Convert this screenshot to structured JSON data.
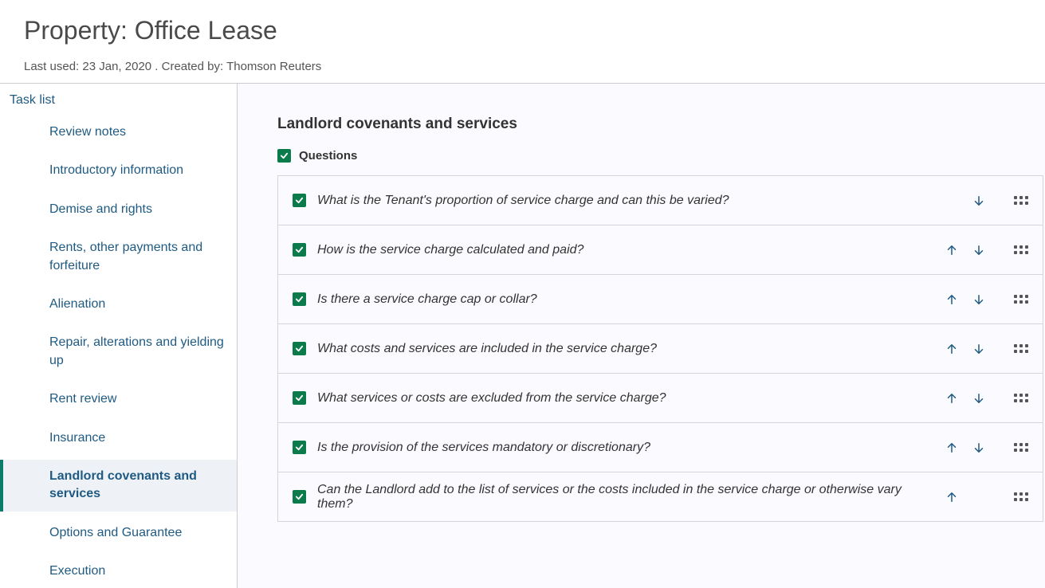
{
  "header": {
    "title": "Property: Office Lease",
    "meta": "Last used: 23 Jan, 2020 . Created by: Thomson Reuters"
  },
  "sidebar": {
    "title": "Task list",
    "items": [
      {
        "label": "Review notes",
        "active": false
      },
      {
        "label": "Introductory information",
        "active": false
      },
      {
        "label": "Demise and rights",
        "active": false
      },
      {
        "label": "Rents, other payments and forfeiture",
        "active": false
      },
      {
        "label": "Alienation",
        "active": false
      },
      {
        "label": "Repair, alterations and yielding up",
        "active": false
      },
      {
        "label": "Rent review",
        "active": false
      },
      {
        "label": "Insurance",
        "active": false
      },
      {
        "label": "Landlord covenants and services",
        "active": true
      },
      {
        "label": "Options and Guarantee",
        "active": false
      },
      {
        "label": "Execution",
        "active": false
      }
    ]
  },
  "main": {
    "section_title": "Landlord covenants and services",
    "questions_label": "Questions",
    "questions": [
      {
        "text": "What is the Tenant's proportion of service charge and can this be varied?",
        "up": false,
        "down": true
      },
      {
        "text": "How is the service charge calculated and paid?",
        "up": true,
        "down": true
      },
      {
        "text": "Is there a service charge cap or collar?",
        "up": true,
        "down": true
      },
      {
        "text": "What costs and services are included in the service charge?",
        "up": true,
        "down": true
      },
      {
        "text": "What services or costs are excluded from the service charge?",
        "up": true,
        "down": true
      },
      {
        "text": "Is the provision of the services mandatory or discretionary?",
        "up": true,
        "down": true
      },
      {
        "text": "Can the Landlord add to the list of services or the costs included in the service charge or otherwise vary them?",
        "up": true,
        "down": false
      }
    ]
  }
}
